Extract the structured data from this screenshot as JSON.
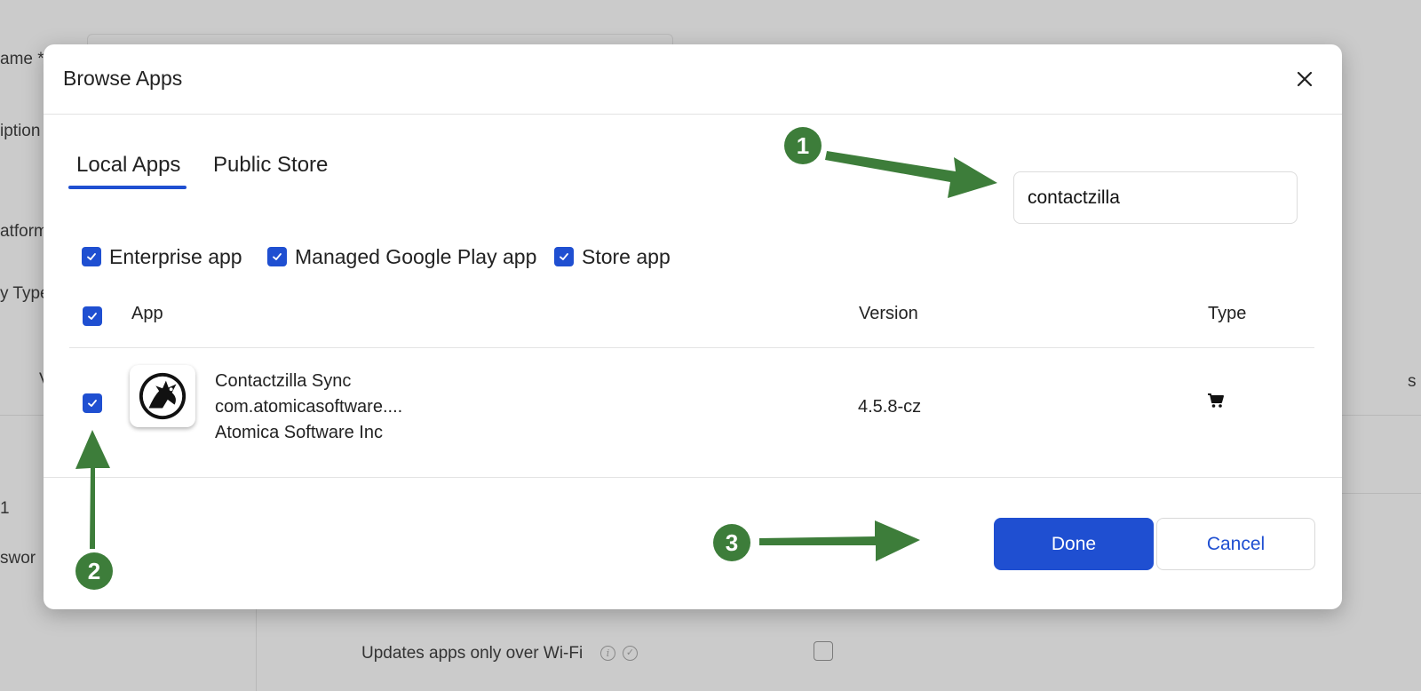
{
  "background": {
    "labels": [
      "ame *",
      "iption",
      "atform",
      "y Type",
      "V",
      "s",
      "1",
      "swor"
    ],
    "updates_label": "Updates apps only over Wi-Fi",
    "info_icon": "info-icon",
    "verified_icon": "check-circle-icon"
  },
  "modal": {
    "title": "Browse Apps",
    "close_icon": "close-icon",
    "tabs": [
      {
        "label": "Local Apps",
        "active": true
      },
      {
        "label": "Public Store",
        "active": false
      }
    ],
    "search": {
      "value": "contactzilla",
      "placeholder": ""
    },
    "filters": [
      {
        "label": "Enterprise app",
        "checked": true
      },
      {
        "label": "Managed Google Play app",
        "checked": true
      },
      {
        "label": "Store app",
        "checked": true
      }
    ],
    "table": {
      "headers": {
        "app": "App",
        "version": "Version",
        "type": "Type"
      },
      "select_all_checked": true,
      "rows": [
        {
          "checked": true,
          "name": "Contactzilla Sync",
          "package": "com.atomicasoftware....",
          "developer": "Atomica Software Inc",
          "version": "4.5.8-cz",
          "type_icon": "shopping-cart-icon"
        }
      ]
    },
    "buttons": {
      "done": "Done",
      "cancel": "Cancel"
    }
  },
  "annotations": {
    "markers": [
      "1",
      "2",
      "3"
    ],
    "color": "#3d7d3a"
  },
  "colors": {
    "accent": "#1f4fd1",
    "annotation": "#3d7d3a"
  }
}
